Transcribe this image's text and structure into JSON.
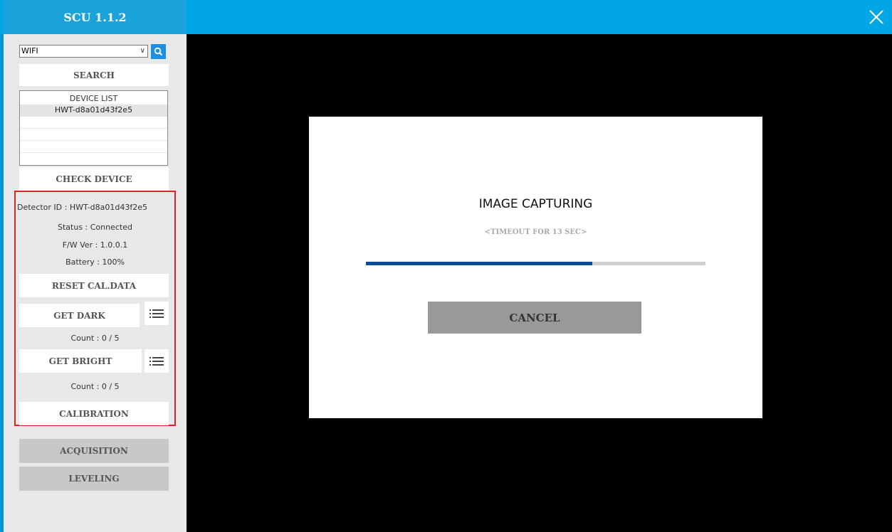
{
  "app": {
    "title": "SCU 1.1.2"
  },
  "search": {
    "select_value": "WIFI",
    "search_button": "SEARCH"
  },
  "device_list": {
    "header": "DEVICE LIST",
    "items": [
      "HWT-d8a01d43f2e5",
      "",
      "",
      ""
    ]
  },
  "check_device": "CHECK DEVICE",
  "info": {
    "detector_id": "Detector ID  : HWT-d8a01d43f2e5",
    "status": "Status : Connected",
    "fw_ver": "F/W Ver : 1.0.0.1",
    "battery": "Battery : 100%"
  },
  "buttons": {
    "reset_cal": "RESET CAL.DATA",
    "get_dark": "GET DARK",
    "dark_count": "Count : 0 / 5",
    "get_bright": "GET BRIGHT",
    "bright_count": "Count : 0 / 5",
    "calibration": "CALIBRATION",
    "acquisition": "ACQUISITION",
    "leveling": "LEVELING"
  },
  "dialog": {
    "title": "IMAGE CAPTURING",
    "subtitle": "<TIMEOUT FOR 13 SEC>",
    "progress_fraction": 0.667,
    "cancel": "CANCEL"
  },
  "icons": {
    "close": "close-icon",
    "search": "search-icon",
    "list": "list-icon",
    "dropdown": "chevron-down-icon"
  },
  "colors": {
    "titlebar": "#00a6e6",
    "accent": "#1d8fe0",
    "progress": "#0f4c96",
    "highlight_border": "#e32020"
  }
}
